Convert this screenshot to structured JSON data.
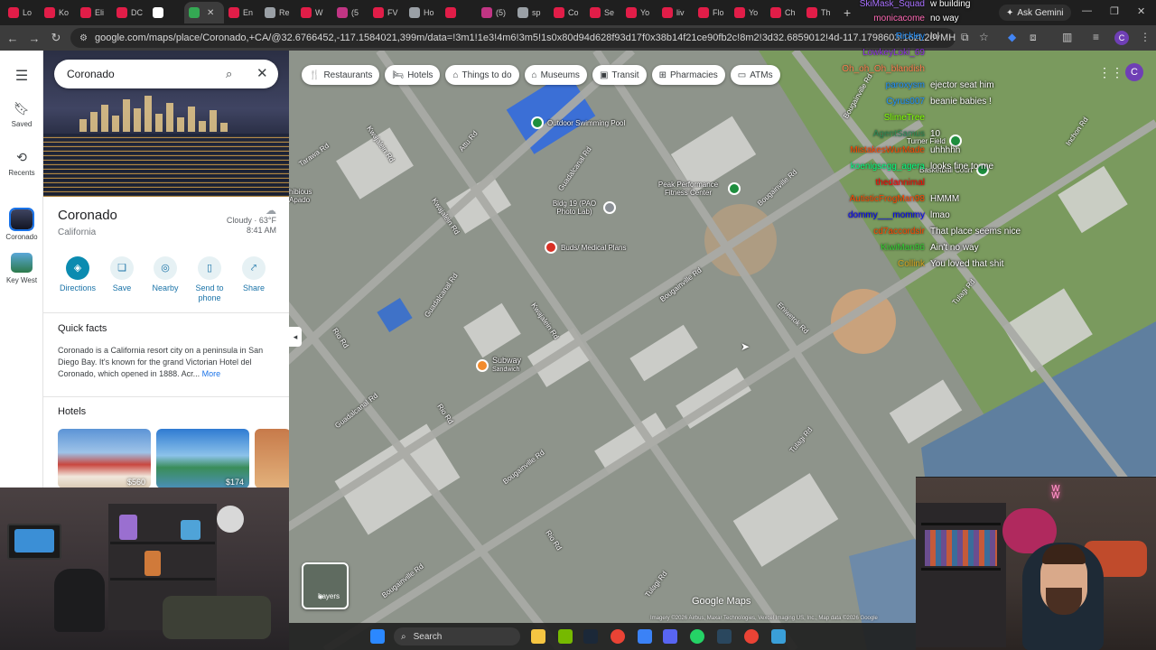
{
  "browser": {
    "tabs": [
      {
        "label": "Lo",
        "color": "#e11d48"
      },
      {
        "label": "Ko",
        "color": "#e11d48"
      },
      {
        "label": "Eli",
        "color": "#e11d48"
      },
      {
        "label": "DC",
        "color": "#e11d48"
      },
      {
        "label": "",
        "color": "#ffffff"
      },
      {
        "label": "",
        "color": "#34a853"
      },
      {
        "label": "En",
        "color": "#e11d48"
      },
      {
        "label": "Re",
        "color": "#9aa0a6"
      },
      {
        "label": "W",
        "color": "#e11d48"
      },
      {
        "label": "(5",
        "color": "#c13584"
      },
      {
        "label": "FV",
        "color": "#e11d48"
      },
      {
        "label": "Ho",
        "color": "#9aa0a6"
      },
      {
        "label": "",
        "color": "#e11d48"
      },
      {
        "label": "(5)",
        "color": "#c13584"
      },
      {
        "label": "sp",
        "color": "#9aa0a6"
      },
      {
        "label": "Co",
        "color": "#e11d48"
      },
      {
        "label": "Se",
        "color": "#e11d48"
      },
      {
        "label": "Yo",
        "color": "#e11d48"
      },
      {
        "label": "liv",
        "color": "#e11d48"
      },
      {
        "label": "Flo",
        "color": "#e11d48"
      },
      {
        "label": "Yo",
        "color": "#e11d48"
      },
      {
        "label": "Ch",
        "color": "#e11d48"
      },
      {
        "label": "Th",
        "color": "#e11d48"
      }
    ],
    "active_tab_index": 5,
    "ask_gemini": "Ask Gemini",
    "url": "google.com/maps/place/Coronado,+CA/@32.6766452,-117.1584021,399m/data=!3m1!1e3!4m6!3m5!1s0x80d94d628f93d17f0x38b14f21ce90fb2c!8m2!3d32.6859012!4d-117.1798603!16zL20vMHI0eHQ?entry=ttu&g_ep=EgoyMDI"
  },
  "rail": {
    "saved": "Saved",
    "recents": "Recents",
    "coronado": "Coronado",
    "key_west": "Key West"
  },
  "place": {
    "search_value": "Coronado",
    "title": "Coronado",
    "subtitle": "California",
    "weather": "Cloudy · 63°F",
    "time": "8:41 AM",
    "actions": {
      "directions": "Directions",
      "save": "Save",
      "nearby": "Nearby",
      "send_to_phone": "Send to phone",
      "share": "Share"
    },
    "quick_facts_title": "Quick facts",
    "quick_facts_text": "Coronado is a California resort city on a peninsula in San Diego Bay. It's known for the grand Victorian Hotel del Coronado, which opened in 1888. Acr...",
    "more": "More",
    "hotels_title": "Hotels",
    "hotels": [
      {
        "price": "$560"
      },
      {
        "price": "$174"
      }
    ]
  },
  "map": {
    "chips": [
      {
        "label": "Restaurants",
        "icon": "fork-knife-icon",
        "glyph": "🍴"
      },
      {
        "label": "Hotels",
        "icon": "bed-icon",
        "glyph": "🛏"
      },
      {
        "label": "Things to do",
        "icon": "camera-icon",
        "glyph": "⌂"
      },
      {
        "label": "Museums",
        "icon": "museum-icon",
        "glyph": "⌂"
      },
      {
        "label": "Transit",
        "icon": "transit-icon",
        "glyph": "▣"
      },
      {
        "label": "Pharmacies",
        "icon": "pharmacy-icon",
        "glyph": "⊞"
      },
      {
        "label": "ATMs",
        "icon": "atm-icon",
        "glyph": "▭"
      }
    ],
    "pois": {
      "pool": "Outdoor Swimming Pool",
      "bldg": "Bldg 19 (PAO Photo Lab)",
      "peak": "Peak Performance Fitness Center",
      "buds": "Buds/ Medical Plans",
      "subway": "Subway",
      "subway_sub": "Sandwich",
      "turner": "Turner Field",
      "basketball": "Basketball Court",
      "tibious": "hibious Apado"
    },
    "streets": {
      "tarawa": "Tarawa Rd",
      "kwajalein1": "Kwajalein Rd",
      "attu": "Attu Rd",
      "guadalcanal1": "Guadalcanal Rd",
      "kwajalein2": "Kwajalein Rd",
      "guadalcanal2": "Guadalcanal Rd",
      "kwajalein3": "Kwajalein Rd",
      "bougainville1": "Bougainville Rd",
      "bougainville2": "Bougainville Rd",
      "bougainville3": "Bougainville Rd",
      "bougainville4": "Bougainville Rd",
      "bougainville5": "Bougainville Rd",
      "eniwetok": "Eniwetok Rd",
      "rio1": "Rio Rd",
      "rio2": "Rio Rd",
      "rio3": "Rio Rd",
      "guadalcanal3": "Guadalcanal Rd",
      "tulagi1": "Tulagi Rd",
      "tulagi2": "Tulagi Rd",
      "tulagi3": "Tulagi Rd",
      "inchon": "Inchon Rd"
    },
    "layers": "Layers",
    "logo": "Google Maps",
    "attribution": "Imagery ©2026 Airbus, Maxar Technologies, Vexcel Imaging US, Inc., Map data ©2026 Google",
    "account_initial": "C"
  },
  "chat": [
    {
      "user": "SkiMask_Squad",
      "text": "w building",
      "color": "#a970ff"
    },
    {
      "user": "monicacome",
      "text": "no way",
      "color": "#ff69b4"
    },
    {
      "user": "Rickley",
      "text": "lol",
      "color": "#1e90ff"
    },
    {
      "user": "LowkeyLoki_69",
      "text": "",
      "color": "#8a2be2"
    },
    {
      "user": "Oh_oh_Oh_blandish",
      "text": "",
      "color": "#ff7f50"
    },
    {
      "user": "paroxysm",
      "text": "ejector seat him",
      "color": "#1e90ff"
    },
    {
      "user": "Cyrus007",
      "text": "beanie babies !",
      "color": "#1e90ff"
    },
    {
      "user": "SlimeTree",
      "text": "",
      "color": "#7fff00"
    },
    {
      "user": "AgentSamus",
      "text": "10",
      "color": "#2e8b57"
    },
    {
      "user": "MistakesWurMade",
      "text": "uhhhhh",
      "color": "#ff4500"
    },
    {
      "user": "koenigsegg_agera",
      "text": "looks fine to me",
      "color": "#00ff7f"
    },
    {
      "user": "thedannimal",
      "text": "",
      "color": "#ff0000"
    },
    {
      "user": "AutisticFrogMan98",
      "text": "HMMM",
      "color": "#ff4500"
    },
    {
      "user": "dommy___mommy",
      "text": "lmao",
      "color": "#0000ff"
    },
    {
      "user": "cd7accordsir",
      "text": "That place seems nice",
      "color": "#ff4500"
    },
    {
      "user": "KiwiMan96",
      "text": "Ain't no way",
      "color": "#32cd32"
    },
    {
      "user": "Collink",
      "text": "You loved that shit",
      "color": "#daa520"
    }
  ],
  "taskbar": {
    "search": "Search"
  }
}
